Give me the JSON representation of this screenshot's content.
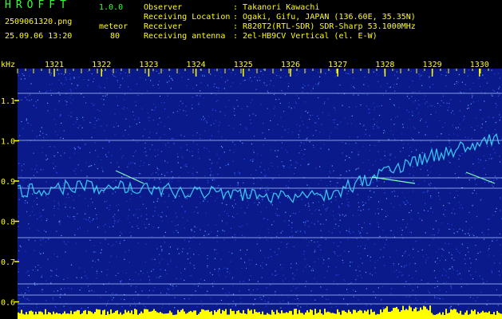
{
  "header": {
    "logo": "HROFFT",
    "version": "1.0.0",
    "filename": "2509061320.png",
    "mode_label": "meteor",
    "timestamp": "25.09.06 13:20",
    "count": "80",
    "fields": [
      {
        "label": "Observer",
        "value": ": Takanori Kawachi"
      },
      {
        "label": "Receiving Location",
        "value": ": Ogaki, Gifu, JAPAN (136.60E, 35.35N)"
      },
      {
        "label": "Receiver",
        "value": ": R820T2(RTL-SDR) SDR-Sharp 53.1000MHz"
      },
      {
        "label": "Receiving antenna",
        "value": ": 2el-HB9CV Vertical (el. E-W)"
      }
    ]
  },
  "spectrogram": {
    "unit": "kHz",
    "time_ticks": [
      "1321",
      "1322",
      "1323",
      "1324",
      "1325",
      "1326",
      "1327",
      "1328",
      "1329",
      "1330"
    ],
    "freq_ticks": [
      "1.1",
      "1.0",
      "0.9",
      "0.8",
      "0.7",
      "0.6"
    ],
    "colors": {
      "background": "#0a1a8a",
      "tick": "#ffff00",
      "hline": "#b0c8ff",
      "trace": "#40e0ff",
      "bottom_bars": "#ffff00"
    }
  }
}
